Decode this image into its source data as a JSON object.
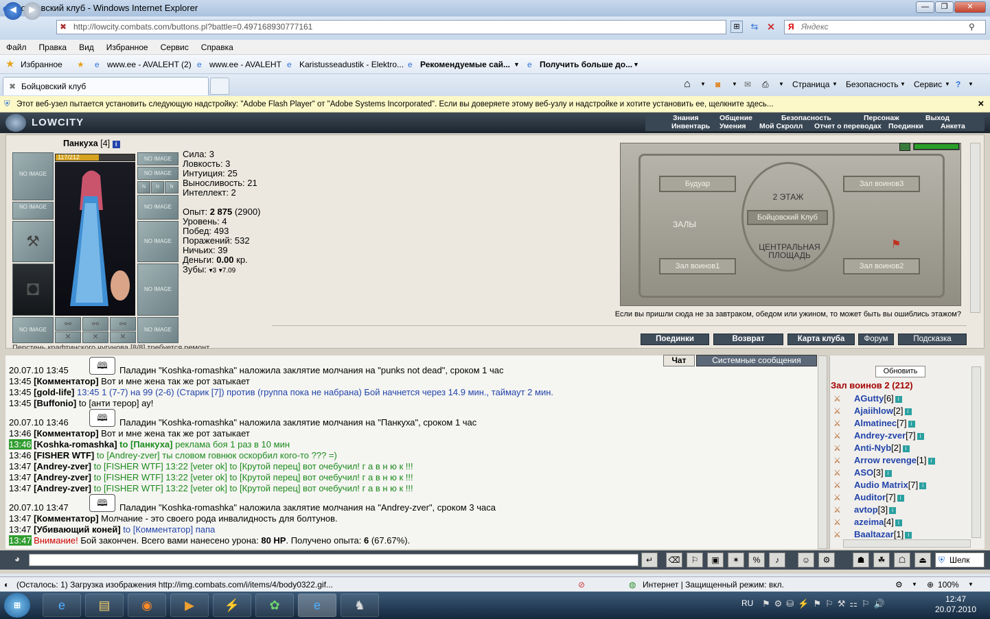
{
  "window": {
    "title": "Бойцовский клуб - Windows Internet Explorer"
  },
  "address": {
    "url": "http://lowcity.combats.com/buttons.pl?battle=0.497168930777161",
    "search_placeholder": "Яндекс"
  },
  "menu": [
    "Файл",
    "Правка",
    "Вид",
    "Избранное",
    "Сервис",
    "Справка"
  ],
  "favorites": {
    "label": "Избранное",
    "items": [
      "www.ee - AVALEHT (2)",
      "www.ee - AVALEHT",
      "Karistusseadustik - Elektro...",
      "Рекомендуемые сай...",
      "Получить больше до..."
    ]
  },
  "tab": {
    "title": "Бойцовский клуб"
  },
  "commandbar": [
    "Страница",
    "Безопасность",
    "Сервис"
  ],
  "infobar": {
    "text": "Этот веб-узел пытается установить следующую надстройку: \"Adobe Flash Player\" от \"Adobe Systems Incorporated\". Если вы доверяете этому веб-узлу и надстройке и хотите установить ее, щелкните здесь..."
  },
  "game": {
    "logo": "LOWCITY",
    "nav_top": [
      "Знания",
      "Общение",
      "Безопасность",
      "Персонаж",
      "Выход"
    ],
    "nav_bottom": [
      "Инвентарь",
      "Умения",
      "Мой Скролл",
      "Отчет о переводах",
      "Поединки",
      "Анкета"
    ],
    "character": {
      "name": "Панкуха",
      "level": "[4]",
      "hp": "117/212",
      "hp_fraction": 0.55,
      "slot_label": "NO IMAGE"
    },
    "stats": [
      "Сила: 3",
      "Ловкость: 3",
      "Интуиция: 25",
      "Выносливость: 21",
      "Интеллект: 2"
    ],
    "stats2": {
      "exp_label": "Опыт: ",
      "exp_value": "2 875",
      "exp_next": " (2900)",
      "level": "Уровень: 4",
      "wins": "Побед: 493",
      "losses": "Поражений: 532",
      "draws": "Ничьих: 39",
      "money_label": "Деньги: ",
      "money_value": "0.00",
      "money_unit": " кр.",
      "teeth_label": "Зубы: ",
      "teeth_a": "3",
      "teeth_b": "7.09"
    },
    "map": {
      "floor": "2 ЭТАЖ",
      "boudoir": "Будуар",
      "hall3": "Зал воинов3",
      "hall1": "Зал воинов1",
      "hall2": "Зал воинов2",
      "club": "Бойцовский Клуб",
      "halls": "ЗАЛЫ",
      "square": "ЦЕНТРАЛЬНАЯ ПЛОЩАДЬ"
    },
    "map_note": "Если вы пришли сюда не за завтраком, обедом или ужином, то может быть вы ошиблись этажом?",
    "buttons": [
      "Поединки",
      "Возврат",
      "Карта клуба",
      "Форум",
      "Подсказка"
    ],
    "chat_tabs": [
      "Чат",
      "Системные сообщения"
    ],
    "room": {
      "refresh": "Обновить",
      "name": "Зал воинов 2 (212)"
    },
    "players": [
      {
        "name": "AGutty",
        "lvl": "[6]"
      },
      {
        "name": "Ajaiihlow",
        "lvl": "[2]"
      },
      {
        "name": "Almatinec",
        "lvl": "[7]"
      },
      {
        "name": "Andrey-zver",
        "lvl": "[7]"
      },
      {
        "name": "Anti-Nyb",
        "lvl": "[2]"
      },
      {
        "name": "Arrow revenge",
        "lvl": "[1]"
      },
      {
        "name": "ASO",
        "lvl": "[3]"
      },
      {
        "name": "Audio Matrix",
        "lvl": "[7]"
      },
      {
        "name": "Auditor",
        "lvl": "[7]"
      },
      {
        "name": "avtop",
        "lvl": "[3]"
      },
      {
        "name": "azeima",
        "lvl": "[4]"
      },
      {
        "name": "Baaltazar",
        "lvl": "[1]"
      }
    ],
    "chat": {
      "l1": {
        "ts": "20.07.10 13:45",
        "text": "Паладин \"Koshka-romashka\" наложила заклятие молчания на \"punks not dead\", сроком 1 час"
      },
      "l2": {
        "ts": "13:45",
        "nick": "[Комментатор]",
        "text": " Вот и мне жена так же рот затыкает"
      },
      "l3": {
        "ts": "13:45",
        "nick": "[gold-life]",
        "text": " 13:45 1 (7-7) на 99 (2-6) (Старик [7]) против (группа пока не набрана) Бой начнется через 14.9 мин., таймаут 2 мин."
      },
      "l4": {
        "ts": "13:45",
        "nick": "[Buffonio]",
        "text": " to [анти терор] ау!"
      },
      "l5": {
        "ts": "20.07.10 13:46",
        "text": "Паладин \"Koshka-romashka\" наложила заклятие молчания на \"Панкуха\", сроком 1 час"
      },
      "l6": {
        "ts": "13:46",
        "nick": "[Комментатор]",
        "text": " Вот и мне жена так же рот затыкает"
      },
      "l7": {
        "ts": "13:46",
        "nick": "[Koshka-romashka]",
        "to": " to [Панкуха]",
        "text": " реклама боя 1 раз в 10 мин"
      },
      "l8": {
        "ts": "13:46",
        "nick": "[FISHER WTF]",
        "text": " to [Andrey-zver] ты словом говнюк оскорбил кого-то ??? =)"
      },
      "l9": {
        "ts": "13:47",
        "nick": "[Andrey-zver]",
        "text": " to [FISHER WTF] 13:22 [veter ok] to [Крутой перец] вот очебучил! г а в н ю к !!!"
      },
      "l12": {
        "ts": "20.07.10 13:47",
        "text": "Паладин \"Koshka-romashka\" наложила заклятие молчания на \"Andrey-zver\", сроком 3 часа"
      },
      "l13": {
        "ts": "13:47",
        "nick": "[Комментатор]",
        "text": " Молчание - это своего рода инвалидность для болтунов."
      },
      "l14": {
        "ts": "13:47",
        "nick": "[Убивающий коней]",
        "text": " to [Комментатор] папа"
      },
      "l15": {
        "ts": "13:47",
        "warn": "Внимание!",
        "text1": " Бой закончен. Всего вами нанесено урона: ",
        "dmg": "80 HP",
        "text2": ". Получено опыта: ",
        "exp": "6",
        "text3": " (67.67%)."
      }
    },
    "under_text": "Перстень крафтинского чугунова [8/8] требуется ремонт"
  },
  "status": {
    "left": "(Осталось: 1) Загрузка изображения http://img.combats.com/i/items/4/body0322.gif...",
    "zone": "Интернет | Защищенный режим: вкл.",
    "zoom": "100%"
  },
  "tray": {
    "lang": "RU",
    "time": "12:47",
    "date": "20.07.2010",
    "shell": "Шелк"
  }
}
